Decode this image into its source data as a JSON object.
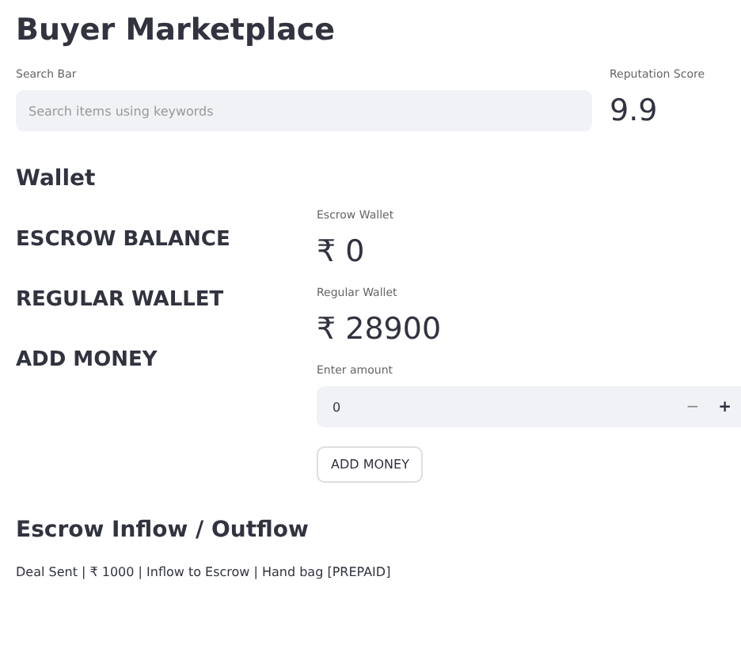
{
  "title": "Buyer Marketplace",
  "search": {
    "label": "Search Bar",
    "placeholder": "Search items using keywords"
  },
  "reputation": {
    "label": "Reputation Score",
    "value": "9.9"
  },
  "wallet": {
    "heading": "Wallet",
    "sections": [
      "ESCROW BALANCE",
      "REGULAR WALLET",
      "ADD MONEY"
    ],
    "metrics": [
      {
        "label": "Escrow Wallet",
        "value": "₹ 0"
      },
      {
        "label": "Regular Wallet",
        "value": "₹ 28900"
      }
    ],
    "amount": {
      "label": "Enter amount",
      "value": "0",
      "decrement": "−",
      "increment": "+"
    },
    "button": "ADD MONEY"
  },
  "flow": {
    "heading": "Escrow Inflow / Outflow",
    "entries": [
      "Deal Sent | ₹ 1000 | Inflow to Escrow | Hand bag [PREPAID]"
    ]
  }
}
